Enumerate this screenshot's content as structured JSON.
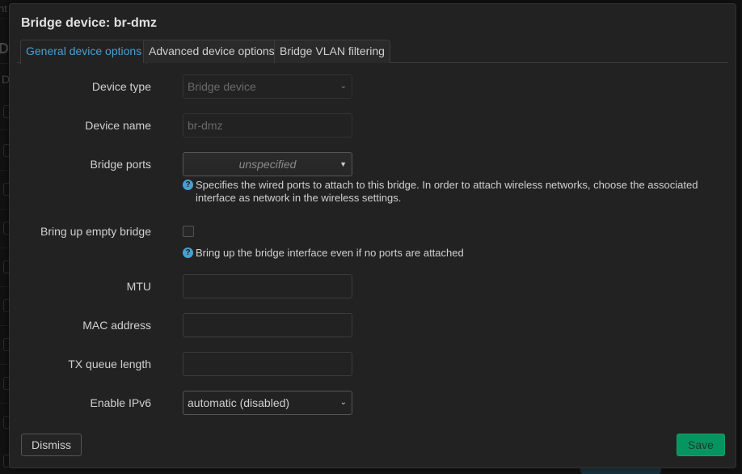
{
  "background": {
    "fragments": [
      "nt",
      "De",
      "D"
    ]
  },
  "modal": {
    "title": "Bridge device: br-dmz",
    "tabs": [
      {
        "label": "General device options",
        "active": true
      },
      {
        "label": "Advanced device options",
        "active": false
      },
      {
        "label": "Bridge VLAN filtering",
        "active": false
      }
    ],
    "fields": {
      "device_type": {
        "label": "Device type",
        "value": "Bridge device",
        "icon": "chevron-down-icon"
      },
      "device_name": {
        "label": "Device name",
        "value": "br-dmz"
      },
      "bridge_ports": {
        "label": "Bridge ports",
        "value": "unspecified",
        "icon": "caret-down-icon",
        "help": "Specifies the wired ports to attach to this bridge. In order to attach wireless networks, choose the associated interface as network in the wireless settings."
      },
      "empty_bridge": {
        "label": "Bring up empty bridge",
        "checked": false,
        "help": "Bring up the bridge interface even if no ports are attached"
      },
      "mtu": {
        "label": "MTU",
        "value": ""
      },
      "mac": {
        "label": "MAC address",
        "value": ""
      },
      "txqueue": {
        "label": "TX queue length",
        "value": ""
      },
      "ipv6": {
        "label": "Enable IPv6",
        "value": "automatic (disabled)",
        "icon": "chevron-down-icon"
      }
    },
    "help_icon": "question-circle-icon",
    "buttons": {
      "dismiss": "Dismiss",
      "save": "Save"
    }
  },
  "colors": {
    "accent": "#4a9fd0",
    "save": "#069560",
    "background": "#222222"
  }
}
